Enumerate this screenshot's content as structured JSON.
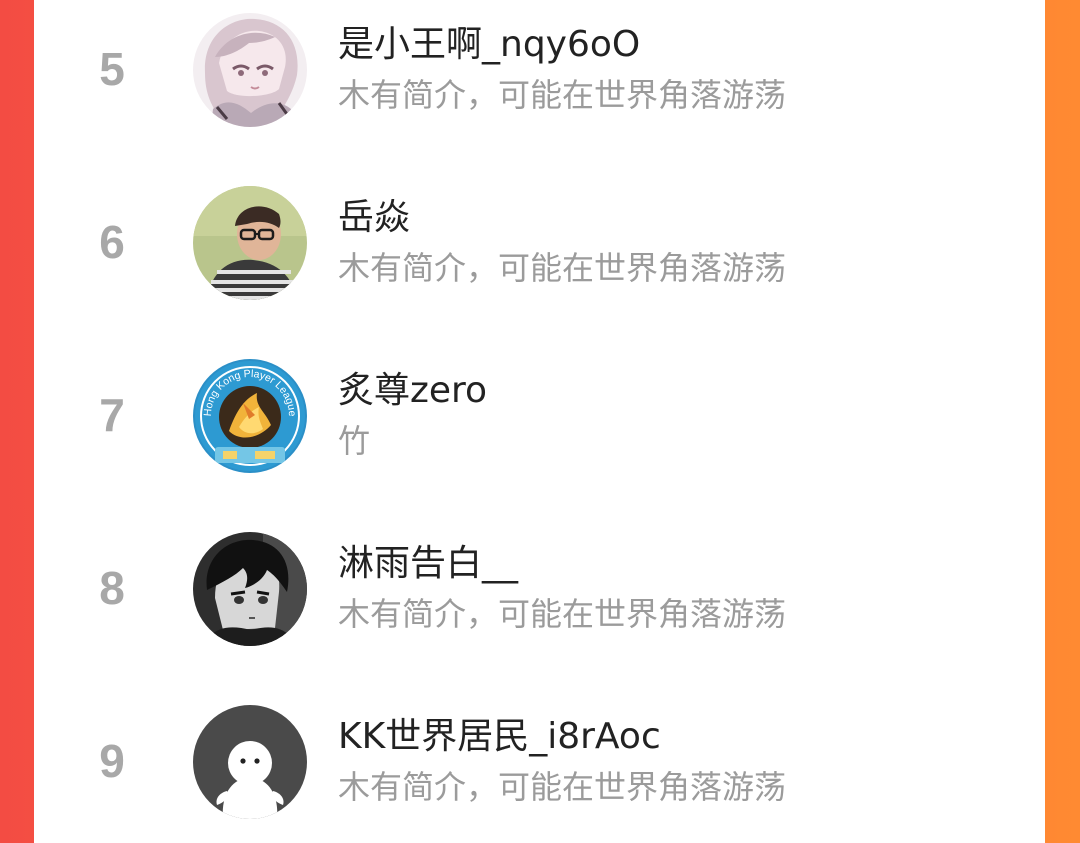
{
  "ranking": {
    "items": [
      {
        "rank": "5",
        "name": "是小王啊_nqy6oO",
        "bio": "木有简介，可能在世界角落游荡",
        "avatar": "anime-avatar-silver-hair"
      },
      {
        "rank": "6",
        "name": "岳焱",
        "bio": "木有简介，可能在世界角落游荡",
        "avatar": "photo-avatar-glasses-man"
      },
      {
        "rank": "7",
        "name": "炙尊zero",
        "bio": "竹",
        "avatar": "badge-avatar-hong-kong-player-league",
        "avatar_badge_text": "Hong Kong Player League"
      },
      {
        "rank": "8",
        "name": "淋雨告白__",
        "bio": "木有简介，可能在世界角落游荡",
        "avatar": "anime-avatar-dark-hair"
      },
      {
        "rank": "9",
        "name": "KK世界居民_i8rAoc",
        "bio": "木有简介，可能在世界角落游荡",
        "avatar": "default-avatar-ghost"
      }
    ]
  },
  "colors": {
    "background_left": "#f34c43",
    "background_right": "#ff8a32",
    "panel": "#ffffff",
    "rank_number": "#a8a8a8",
    "name_text": "#222222",
    "bio_text": "#9b9b9b"
  }
}
